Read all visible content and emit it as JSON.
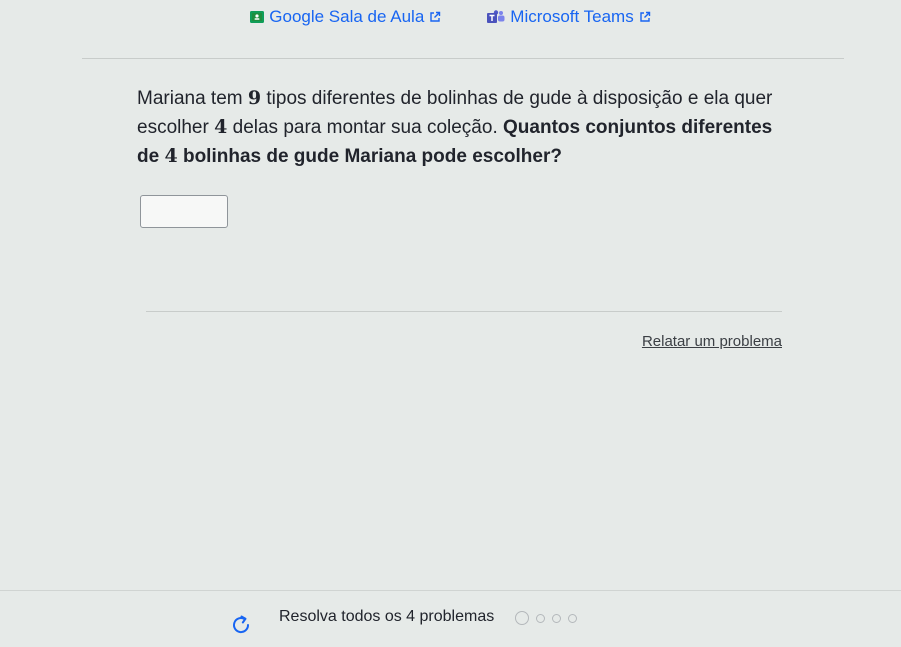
{
  "share": {
    "classroom_label": "Google Sala de Aula",
    "teams_label": "Microsoft Teams"
  },
  "question": {
    "part1": "Mariana tem ",
    "n_total": "9",
    "part2": " tipos diferentes de bolinhas de gude à disposição e ela quer escolher ",
    "n_choose": "4",
    "part3": " delas para montar sua coleção. ",
    "q_part1": "Quantos conjuntos diferentes de ",
    "q_num": "4",
    "q_part2": " bolinhas de gude Mariana pode escolher?"
  },
  "answer": {
    "value": ""
  },
  "report": {
    "label": "Relatar um problema"
  },
  "footer": {
    "progress_text": "Resolva todos os 4 problemas",
    "total_problems": 4,
    "completed": 0
  },
  "colors": {
    "link_blue": "#1865f2",
    "classroom_green": "#0f9d58",
    "teams_purple": "#5059c9",
    "background": "#e6eae8"
  },
  "icons": [
    "google-classroom-icon",
    "microsoft-teams-icon",
    "external-link-icon",
    "reload-icon"
  ]
}
